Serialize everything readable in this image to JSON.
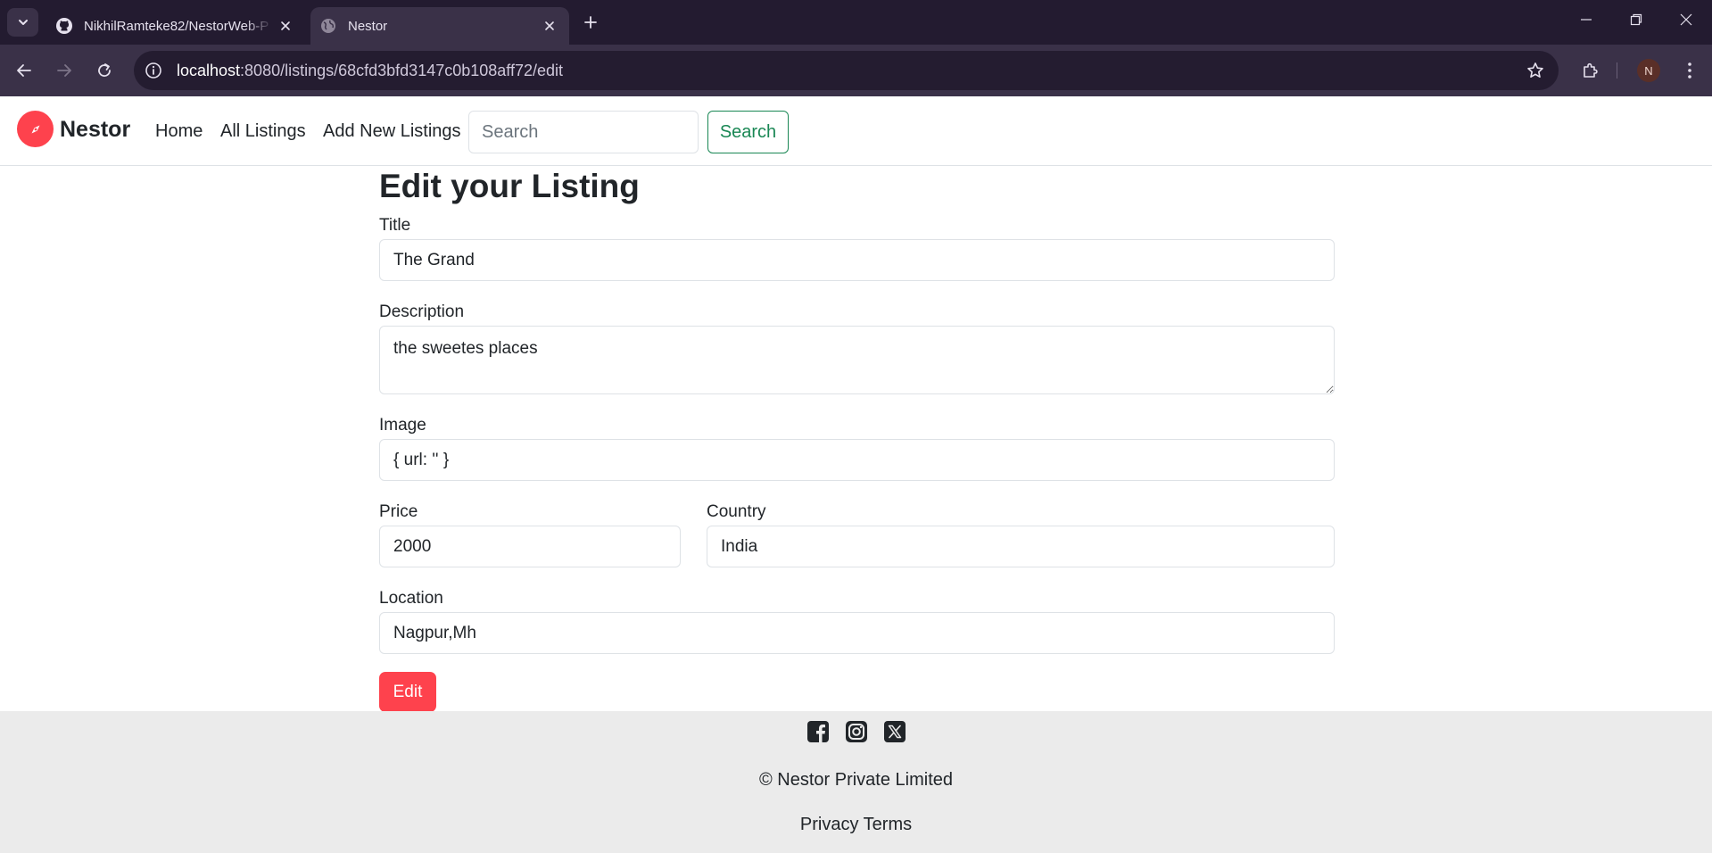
{
  "browser": {
    "tabs": [
      {
        "title": "NikhilRamteke82/NestorWeb-P",
        "icon": "github-icon",
        "active": false
      },
      {
        "title": "Nestor",
        "icon": "globe-icon",
        "active": true
      }
    ],
    "url_host": "localhost",
    "url_rest": ":8080/listings/68cfd3bfd3147c0b108aff72/edit",
    "profile_initial": "N"
  },
  "navbar": {
    "brand": "Nestor",
    "links": [
      "Home",
      "All Listings",
      "Add New Listings"
    ],
    "search_placeholder": "Search",
    "search_button": "Search"
  },
  "form": {
    "heading": "Edit your Listing",
    "title_label": "Title",
    "title_value": "The Grand",
    "description_label": "Description",
    "description_value": "the sweetes places",
    "image_label": "Image",
    "image_value": "{ url: '' }",
    "price_label": "Price",
    "price_value": "2000",
    "country_label": "Country",
    "country_value": "India",
    "location_label": "Location",
    "location_value": "Nagpur,Mh",
    "submit_label": "Edit"
  },
  "footer": {
    "socials": [
      "facebook-icon",
      "instagram-icon",
      "x-icon"
    ],
    "copyright": "© Nestor Private Limited",
    "privacy": "Privacy",
    "terms": "Terms"
  },
  "colors": {
    "brand": "#fe424d",
    "search_button": "#198754",
    "footer_bg": "#ebebeb",
    "chrome_dark": "#231b30",
    "chrome_toolbar": "#3a3148"
  }
}
